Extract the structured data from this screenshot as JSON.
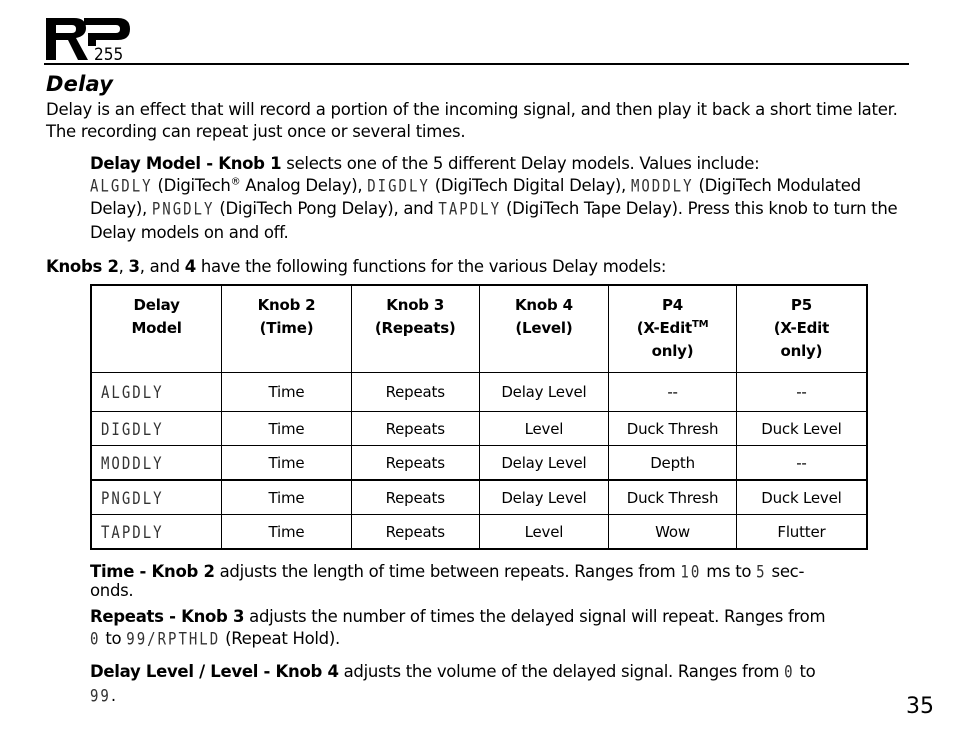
{
  "header": {
    "logo_text": "RP",
    "logo_model": "255"
  },
  "section": {
    "title": "Delay",
    "intro": "Delay is an effect that will record a portion of the incoming signal, and then play it back a short time later.  The recording can repeat just once or several times."
  },
  "model_para": {
    "lead": "Delay Model - Knob 1",
    "t1": " selects one of the 5 different Delay models. Values include: ",
    "m1": "ALGDLY",
    "t2": " (DigiTech",
    "reg": "®",
    "t3": " Analog Delay), ",
    "m2": "DIGDLY",
    "t4": " (DigiTech Digital Delay), ",
    "m3": "MODDLY",
    "t5": " (DigiTech Modulated Delay), ",
    "m4": "PNGDLY",
    "t6": " (DigiTech Pong Delay), and ",
    "m5": "TAPDLY",
    "t7": " (DigiTech Tape Delay). Press this knob to turn the Delay models on and off."
  },
  "knobs_para": {
    "k2": "Knobs 2",
    "sep1": ", ",
    "k3": "3",
    "sep2": ", and ",
    "k4": "4",
    "rest": " have the following functions for the various Delay models:"
  },
  "table": {
    "headers": [
      {
        "line1": "Delay",
        "line2": "Model",
        "line3": ""
      },
      {
        "line1": "Knob 2",
        "line2": "(Time)",
        "line3": ""
      },
      {
        "line1": "Knob 3",
        "line2": "(Repeats)",
        "line3": ""
      },
      {
        "line1": "Knob 4",
        "line2": "(Level)",
        "line3": ""
      },
      {
        "line1": "P4",
        "line2": "(X-Edit",
        "tm": "TM",
        "line3": "only)"
      },
      {
        "line1": "P5",
        "line2": "(X-Edit",
        "line3": "only)"
      }
    ],
    "rows": [
      [
        "ALGDLY",
        "Time",
        "Repeats",
        "Delay Level",
        "--",
        "--"
      ],
      [
        "DIGDLY",
        "Time",
        "Repeats",
        "Level",
        "Duck Thresh",
        "Duck Level"
      ],
      [
        "MODDLY",
        "Time",
        "Repeats",
        "Delay Level",
        "Depth",
        "--"
      ],
      [
        "PNGDLY",
        "Time",
        "Repeats",
        "Delay Level",
        "Duck Thresh",
        "Duck Level"
      ],
      [
        "TAPDLY",
        "Time",
        "Repeats",
        "Level",
        "Wow",
        "Flutter"
      ]
    ]
  },
  "time_para": {
    "lead": "Time - Knob 2",
    "t1": " adjusts the length of time between repeats. Ranges from ",
    "v1": "10",
    "t2": " ms to ",
    "v2": "5",
    "t3": " sec-",
    "t4": "onds."
  },
  "repeats_para": {
    "lead": "Repeats - Knob 3",
    "t1": " adjusts the number of times the delayed signal will repeat. Ranges from ",
    "v1": "0",
    "t2": " to ",
    "v2": "99/RPTHLD",
    "t3": " (Repeat Hold)."
  },
  "level_para": {
    "lead": "Delay Level / Level - Knob 4",
    "t1": " adjusts the volume of the delayed signal. Ranges from ",
    "v1": "0",
    "t2": " to ",
    "v2": "99",
    "t3": "."
  },
  "page_number": "35"
}
